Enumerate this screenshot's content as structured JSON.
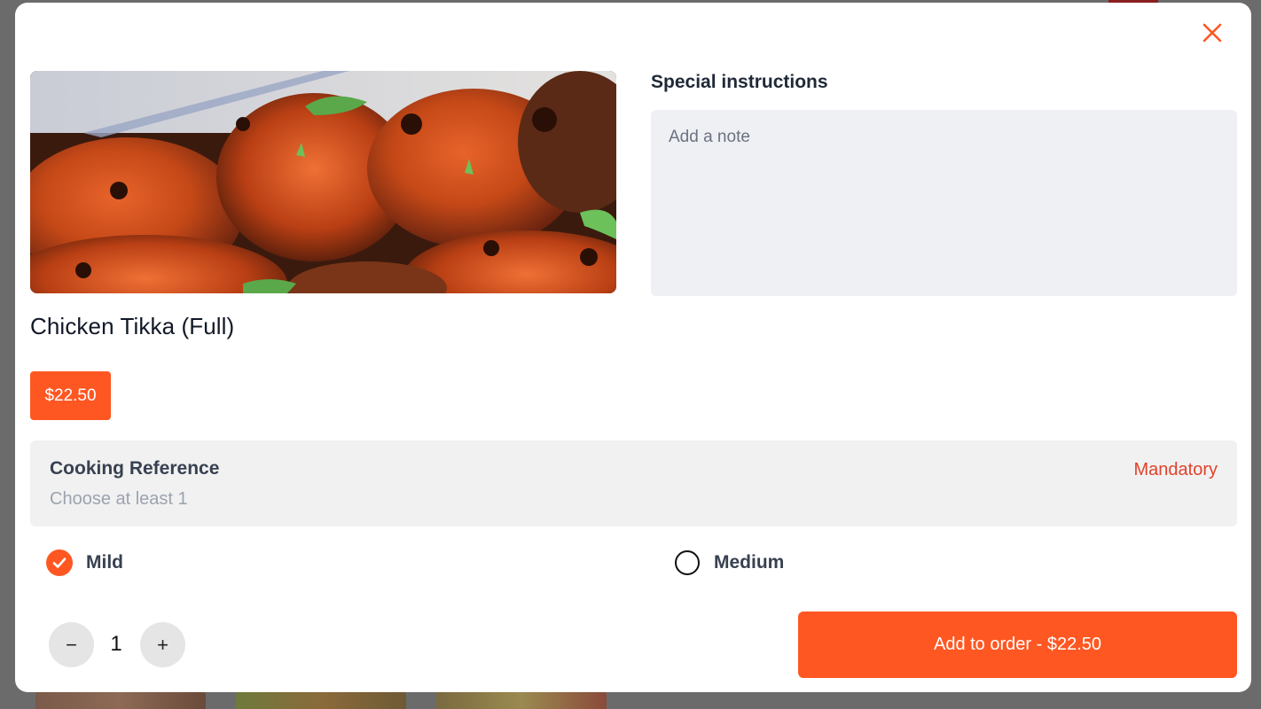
{
  "modal": {
    "close_icon": "close-icon",
    "accent_color": "#ff5722"
  },
  "item": {
    "name": "Chicken Tikka (Full)",
    "price": "$22.50",
    "image_alt": "Chicken Tikka"
  },
  "special_instructions": {
    "label": "Special instructions",
    "placeholder": "Add a note",
    "value": ""
  },
  "option_group": {
    "title": "Cooking Reference",
    "subtitle": "Choose at least 1",
    "requirement": "Mandatory",
    "requirement_color": "#e0422b",
    "choices": [
      {
        "label": "Mild",
        "selected": true
      },
      {
        "label": "Medium",
        "selected": false
      }
    ]
  },
  "quantity": {
    "value": "1",
    "minus_symbol": "−",
    "plus_symbol": "+"
  },
  "cta": {
    "label": "Add to order - $22.50"
  }
}
